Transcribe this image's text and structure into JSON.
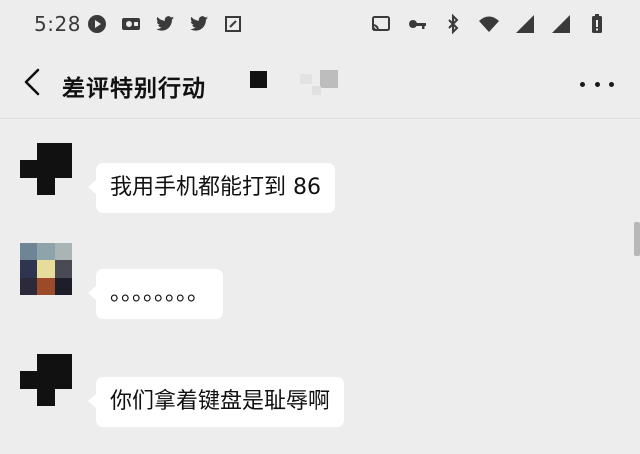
{
  "status_bar": {
    "time": "5:28",
    "left_icons": [
      "play-circle-icon",
      "notification-icon",
      "twitter-icon",
      "twitter-icon",
      "screenshot-icon"
    ],
    "right_icons": [
      "cast-icon",
      "key-icon",
      "bluetooth-icon",
      "wifi-icon",
      "signal-icon",
      "signal-icon",
      "battery-icon"
    ]
  },
  "header": {
    "title": "差评特别行动"
  },
  "messages": [
    {
      "text": "我用手机都能打到 86"
    },
    {
      "text": "。。。。。。。。"
    },
    {
      "text": "你们拿着键盘是耻辱啊"
    }
  ]
}
